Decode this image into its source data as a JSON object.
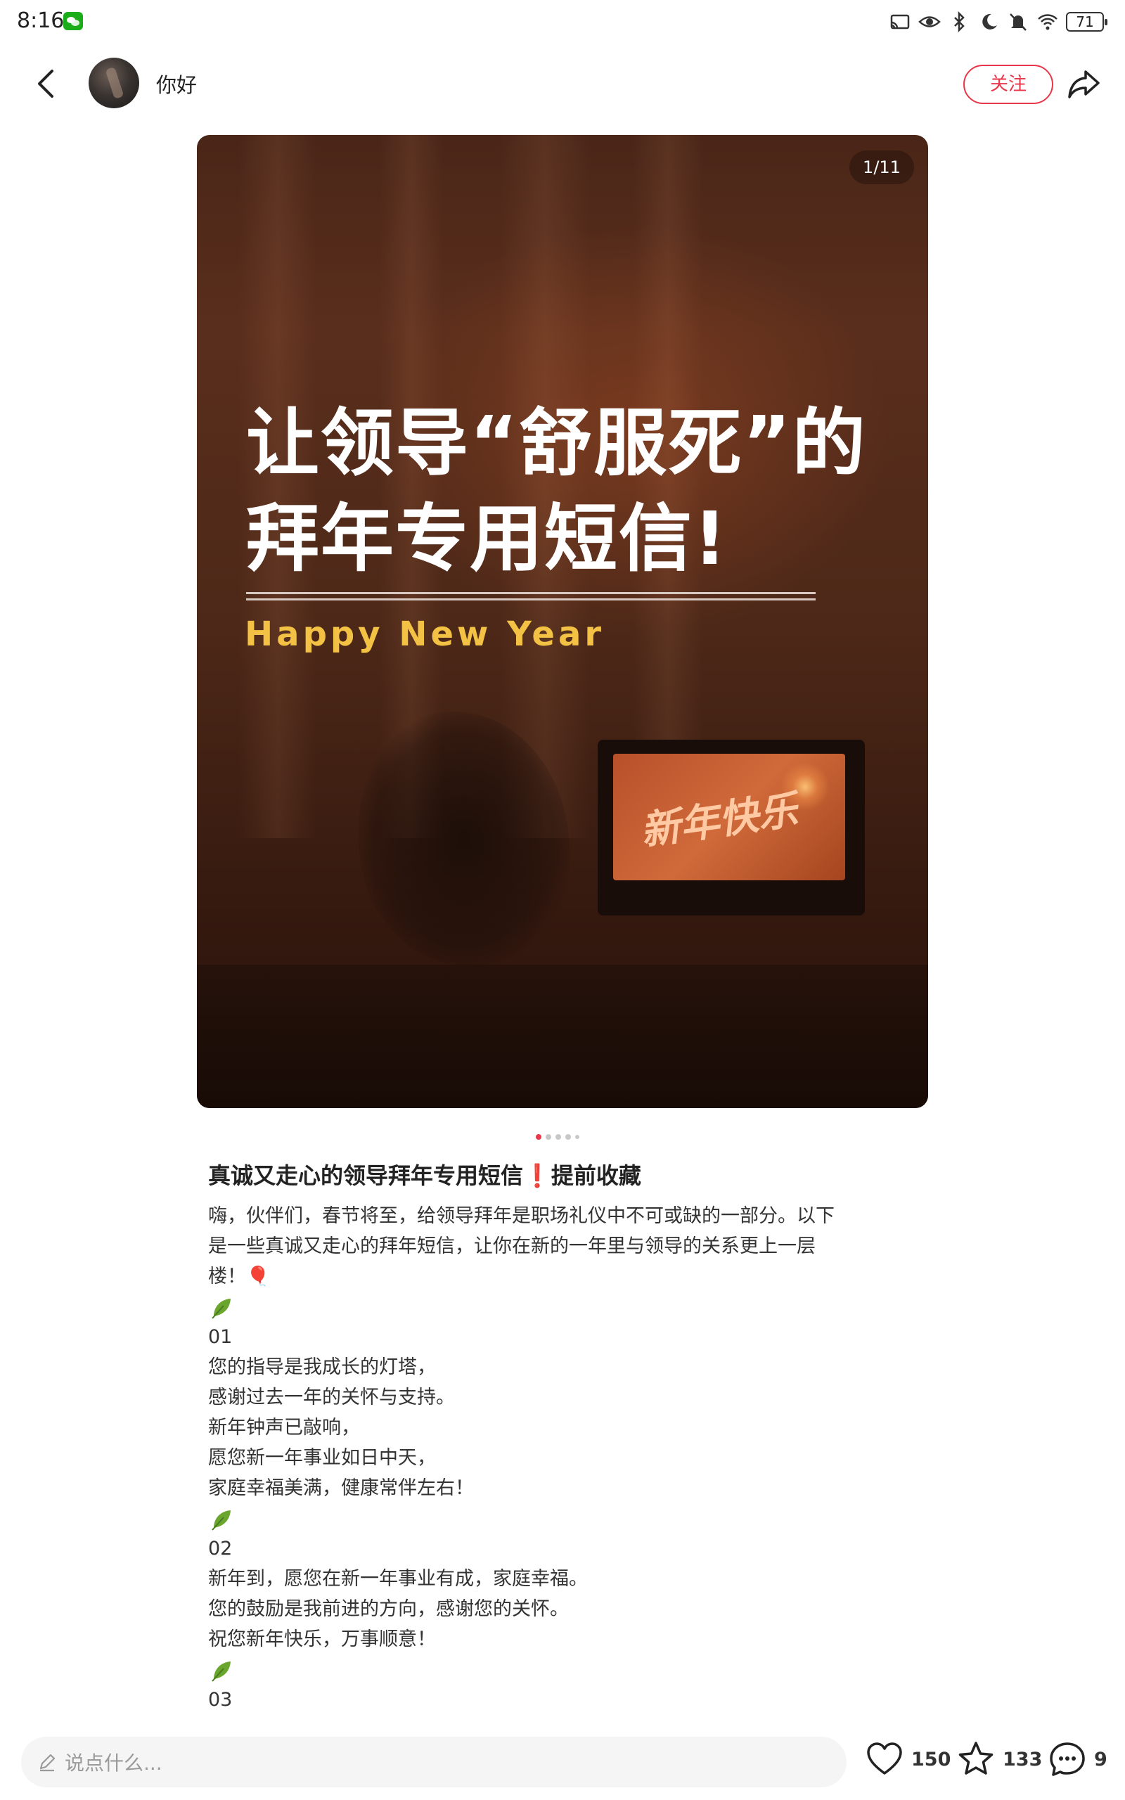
{
  "status_bar": {
    "time": "8:16",
    "battery": "71"
  },
  "header": {
    "username": "你好",
    "follow_label": "关注"
  },
  "image": {
    "page_indicator": "1/11",
    "title_line1": "让领导“舒服死”的",
    "title_line2": "拜年专用短信!",
    "subtitle": "Happy New Year",
    "tv_text": "新年快乐"
  },
  "carousel": {
    "total_dots": 5,
    "active_index": 0
  },
  "post": {
    "title": "真诚又走心的领导拜年专用短信❗提前收藏",
    "body_lines": [
      "嗨，伙伴们，春节将至，给领导拜年是职场礼仪中不可或缺的一部分。以下",
      "是一些真诚又走心的拜年短信，让你在新的一年里与领导的关系更上一层",
      "楼！🎈"
    ],
    "sections": [
      {
        "number": "01",
        "lines": [
          "您的指导是我成长的灯塔，",
          "感谢过去一年的关怀与支持。",
          "新年钟声已敲响，",
          "愿您新一年事业如日中天，",
          "家庭幸福美满，健康常伴左右！"
        ]
      },
      {
        "number": "02",
        "lines": [
          "新年到，愿您在新一年事业有成，家庭幸福。",
          "您的鼓励是我前进的方向，感谢您的关怀。",
          "祝您新年快乐，万事顺意！"
        ]
      },
      {
        "number": "03",
        "lines": []
      }
    ]
  },
  "bottom_bar": {
    "comment_placeholder": "说点什么...",
    "likes": "150",
    "favorites": "133",
    "comments": "9"
  },
  "colors": {
    "accent": "#e8374a",
    "subtitle_gold": "#f3c244",
    "leaf_green": "#6aa62e"
  },
  "icons": [
    "cast-icon",
    "eye-icon",
    "bluetooth-icon",
    "moon-icon",
    "mute-bell-icon",
    "wifi-icon",
    "back-arrow-icon",
    "share-icon",
    "pencil-icon",
    "heart-icon",
    "star-icon",
    "comment-bubble-icon",
    "leaf-icon"
  ]
}
